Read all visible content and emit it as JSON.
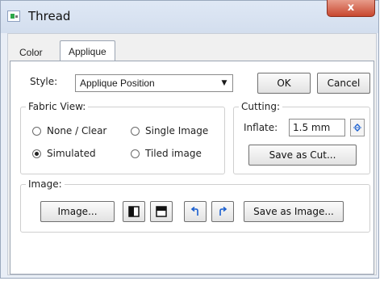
{
  "window": {
    "title": "Thread",
    "close_glyph": "x"
  },
  "tabs": [
    {
      "label": "Color"
    },
    {
      "label": "Applique"
    }
  ],
  "style": {
    "label": "Style:",
    "selected": "Applique Position"
  },
  "buttons": {
    "ok": "OK",
    "cancel": "Cancel"
  },
  "fabric_view": {
    "title": "Fabric View:",
    "options": [
      {
        "label": "None / Clear",
        "checked": false
      },
      {
        "label": "Single Image",
        "checked": false
      },
      {
        "label": "Simulated",
        "checked": true
      },
      {
        "label": "Tiled image",
        "checked": false
      }
    ]
  },
  "cutting": {
    "title": "Cutting:",
    "inflate_label": "Inflate:",
    "inflate_value": "1.5 mm",
    "save_as_cut": "Save as Cut..."
  },
  "image": {
    "title": "Image:",
    "image_button": "Image...",
    "save_as_image": "Save as Image...",
    "icons": [
      "split-vertical-icon",
      "split-horizontal-icon",
      "rotate-left-icon",
      "rotate-right-icon"
    ]
  },
  "colors": {
    "accent_blue": "#1a5fd0",
    "close_red": "#c8472f",
    "titlebar": "#d3deee"
  }
}
